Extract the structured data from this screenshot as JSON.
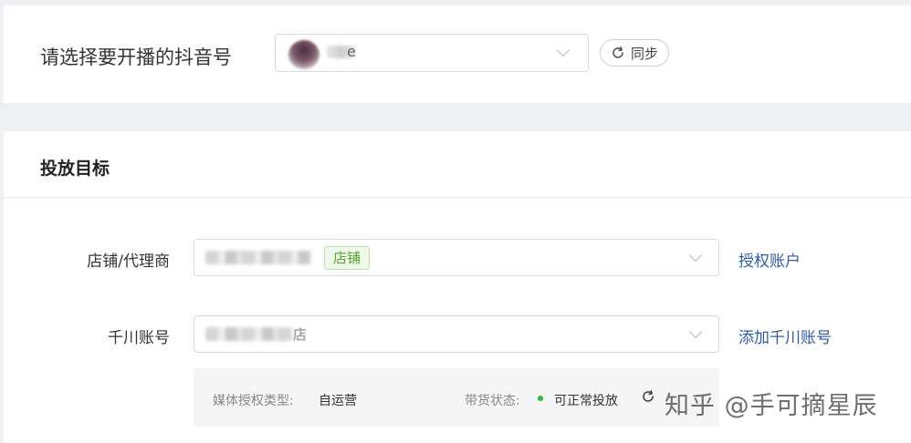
{
  "account_row": {
    "label": "请选择要开播的抖音号",
    "selected_suffix": "e",
    "sync_label": "同步"
  },
  "target_section": {
    "title": "投放目标",
    "store": {
      "label": "店铺/代理商",
      "tag": "店铺",
      "action_link": "授权账户"
    },
    "qianchuan": {
      "label": "千川账号",
      "value_suffix": "店",
      "action_link": "添加千川账号"
    },
    "info": {
      "auth_type_label": "媒体授权类型:",
      "auth_type_value": "自运营",
      "status_label": "带货状态:",
      "status_value": "可正常投放"
    }
  },
  "watermark": "知乎 @手可摘星辰",
  "colors": {
    "link": "#2f5aa8",
    "tag_green": "#52a62e",
    "status_dot": "#34b734"
  },
  "icons": [
    "chevron-down-icon",
    "refresh-icon"
  ]
}
